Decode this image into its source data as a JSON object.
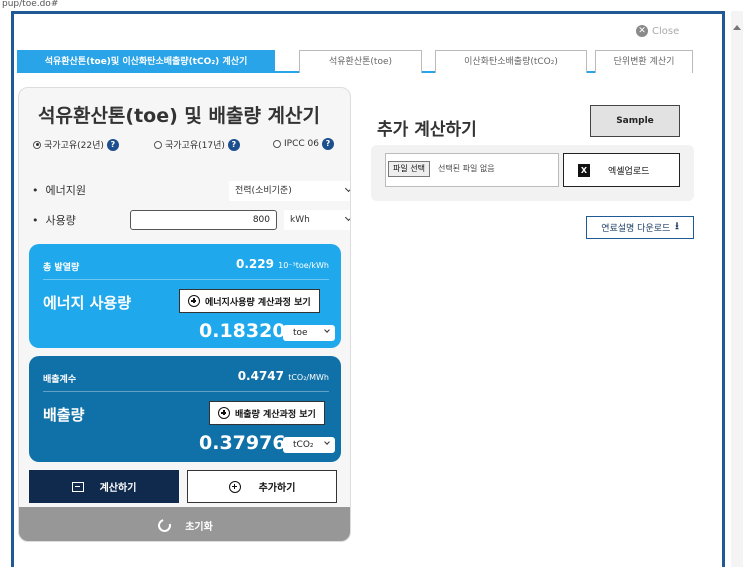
{
  "url_fragment": "pup/toe.do#",
  "close_label": "Close",
  "tabs": [
    {
      "label": "석유환산톤(toe)및 이산화탄소배출량(tCO₂) 계산기"
    },
    {
      "label": "석유환산톤(toe)"
    },
    {
      "label": "이산화탄소배출량(tCO₂)"
    },
    {
      "label": "단위변환 계산기"
    }
  ],
  "calculator": {
    "title": "석유환산톤(toe) 및 배출량 계산기",
    "radios": [
      {
        "label": "국가고유(22년)",
        "checked": true
      },
      {
        "label": "국가고유(17년)",
        "checked": false
      },
      {
        "label": "IPCC 06",
        "checked": false
      }
    ],
    "help_glyph": "?",
    "energy_source_label": "에너지원",
    "energy_source_value": "전력(소비기준)",
    "usage_label": "사용량",
    "usage_value": "800",
    "usage_unit": "kWh",
    "energy_card": {
      "sub_label": "총 발열량",
      "rate_value": "0.229",
      "rate_unit": "10⁻³toe/kWh",
      "heading": "에너지 사용량",
      "button_label": "에너지사용량 계산과정 보기",
      "result_value": "0.18320",
      "result_unit": "toe"
    },
    "emission_card": {
      "sub_label": "배출계수",
      "rate_value": "0.4747",
      "rate_unit": "tCO₂/MWh",
      "heading": "배출량",
      "button_label": "배출량 계산과정 보기",
      "result_value": "0.37976",
      "result_unit": "tCO₂"
    },
    "calc_button": "계산하기",
    "add_button": "추가하기",
    "reset_button": "초기화"
  },
  "add_panel": {
    "title": "추가 계산하기",
    "sample_button": "Sample",
    "file_choose": "파일 선택",
    "file_none": "선택된 파일 없음",
    "excel_icon_glyph": "X",
    "excel_upload": "엑셀업로드",
    "fuel_download": "연료설명 다운로드"
  },
  "colors": {
    "tab_active": "#2aa4e8",
    "energy_card": "#1fa9ec",
    "emission_card": "#1071a8",
    "calc_button": "#0f2a4d",
    "reset_button": "#979797"
  }
}
